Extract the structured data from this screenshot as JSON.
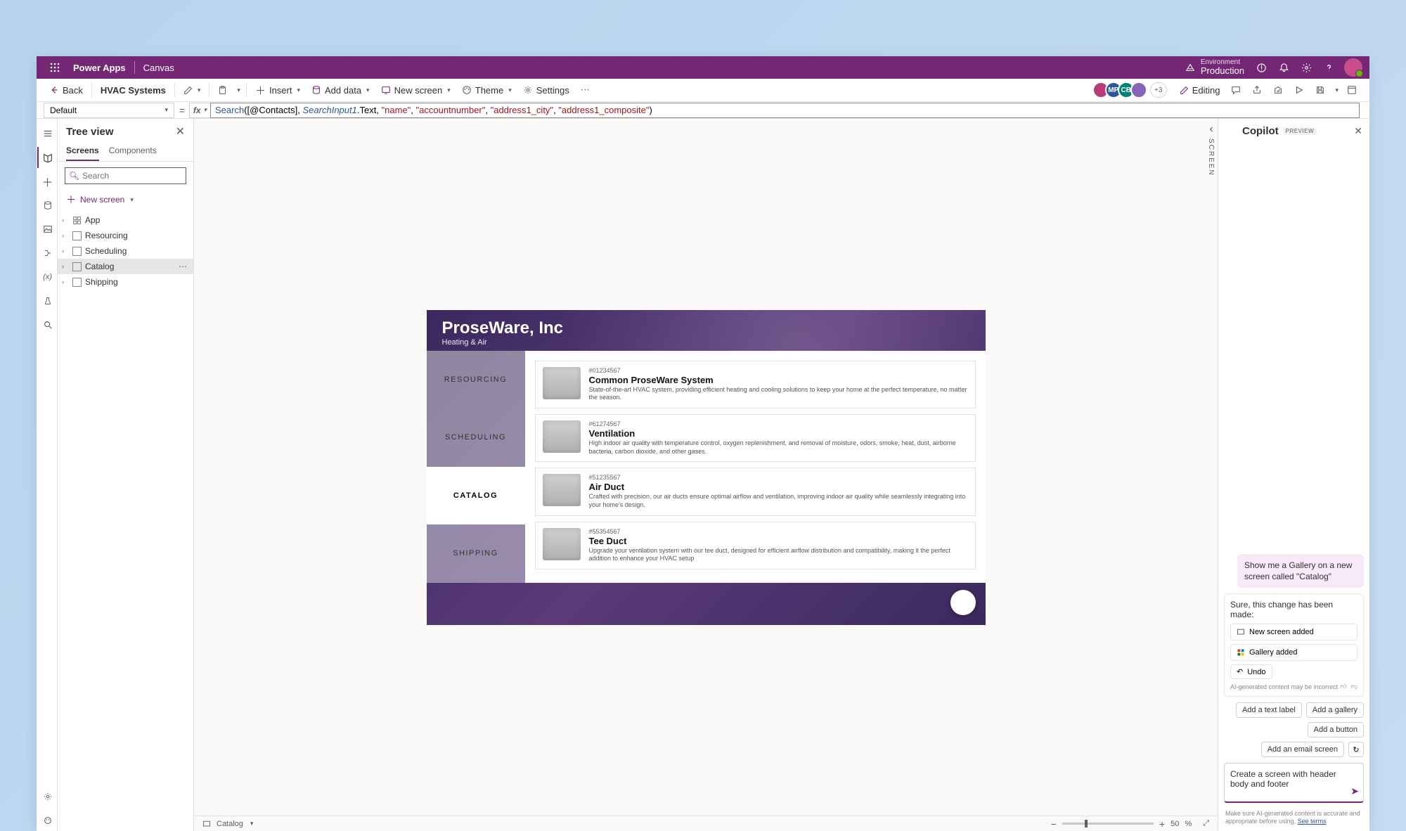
{
  "titlebar": {
    "appName": "Power Apps",
    "mode": "Canvas",
    "envLabel": "Environment",
    "envValue": "Production"
  },
  "toolbar": {
    "back": "Back",
    "breadcrumb": "HVAC Systems",
    "insert": "Insert",
    "addData": "Add data",
    "newScreen": "New screen",
    "theme": "Theme",
    "settings": "Settings",
    "editing": "Editing",
    "presenceMore": "+3"
  },
  "formula": {
    "property": "Default",
    "parts": {
      "fn": "Search",
      "open": "(",
      "arg1": "[@Contacts]",
      "sep1": ", ",
      "ident": "SearchInput1",
      "dot": ".Text, ",
      "s1": "\"name\"",
      "c1": ", ",
      "s2": "\"accountnumber\"",
      "c2": ", ",
      "s3": "\"address1_city\"",
      "c3": ", ",
      "s4": "\"address1_composite\"",
      "close": ")"
    }
  },
  "treeview": {
    "title": "Tree view",
    "tabs": {
      "screens": "Screens",
      "components": "Components"
    },
    "searchPlaceholder": "Search",
    "newScreen": "New screen",
    "items": [
      {
        "label": "App",
        "selected": false,
        "isApp": true
      },
      {
        "label": "Resourcing",
        "selected": false
      },
      {
        "label": "Scheduling",
        "selected": false
      },
      {
        "label": "Catalog",
        "selected": true
      },
      {
        "label": "Shipping",
        "selected": false
      }
    ]
  },
  "rightLabel": "SCREEN",
  "appPreview": {
    "company": "ProseWare, Inc",
    "subtitle": "Heating & Air",
    "nav": [
      "RESOURCING",
      "SCHEDULING",
      "CATALOG",
      "SHIPPING"
    ],
    "activeNav": 2,
    "cards": [
      {
        "sku": "#01234567",
        "title": "Common ProseWare System",
        "desc": "State-of-the-art HVAC system, providing efficient heating and cooling solutions to keep your home at the perfect temperature, no matter the season."
      },
      {
        "sku": "#61274567",
        "title": "Ventilation",
        "desc": "High indoor air quality with temperature control, oxygen replenishment, and removal of moisture, odors, smoke, heat, dust, airborne bacteria, carbon dioxide, and other gases."
      },
      {
        "sku": "#51235567",
        "title": "Air Duct",
        "desc": "Crafted with precision, our air ducts ensure optimal airflow and ventilation, improving indoor air quality while seamlessly integrating into your home's design."
      },
      {
        "sku": "#55354567",
        "title": "Tee Duct",
        "desc": "Upgrade your ventilation system with our tee duct, designed for efficient airflow distribution and compatibility, making it the perfect addition to enhance your HVAC setup"
      }
    ]
  },
  "statusbar": {
    "selection": "Catalog",
    "zoomValue": "50",
    "zoomUnit": "%"
  },
  "copilot": {
    "title": "Copilot",
    "badge": "PREVIEW",
    "userMsg": "Show me a Gallery on a new screen called \"Catalog\"",
    "assistMsg": "Sure, this change has been made:",
    "chips": [
      {
        "label": "New screen added",
        "icon": "screen"
      },
      {
        "label": "Gallery added",
        "icon": "gallery"
      }
    ],
    "undo": "Undo",
    "feedbackText": "AI-generated content may be incorrect",
    "suggestions": [
      "Add a text label",
      "Add a gallery",
      "Add a button",
      "Add an email screen"
    ],
    "inputText": "Create a screen with header body and footer",
    "disclaimer": "Make sure AI-generated content is accurate and appropriate before using. ",
    "seeTerms": "See terms"
  }
}
